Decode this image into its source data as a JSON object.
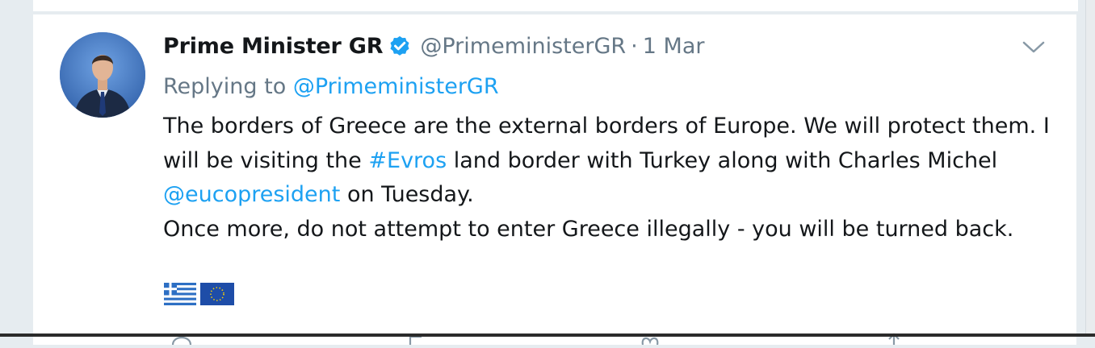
{
  "tweet": {
    "display_name": "Prime Minister GR",
    "handle": "@PrimeministerGR",
    "separator": "·",
    "date": "1 Mar",
    "replying_prefix": "Replying to",
    "replying_handle": "@PrimeministerGR",
    "text_line1": "The borders of Greece are the external borders of Europe. We will protect them. I will be visiting the",
    "hashtag": "#Evros",
    "text_line2": "land border with Turkey along with Charles Michel",
    "mention": "@eucopresident",
    "text_line3": "on Tuesday.",
    "text_line4": "Once more, do not attempt to enter Greece illegally - you will be turned back.",
    "emojis": [
      "greek-flag",
      "eu-flag"
    ]
  },
  "colors": {
    "link": "#1da1f2",
    "text": "#14171a",
    "muted": "#657786",
    "verified": "#1da1f2"
  },
  "icons": [
    "verified-badge-icon",
    "chevron-down-icon",
    "reply-icon",
    "retweet-icon",
    "like-icon",
    "share-icon"
  ]
}
